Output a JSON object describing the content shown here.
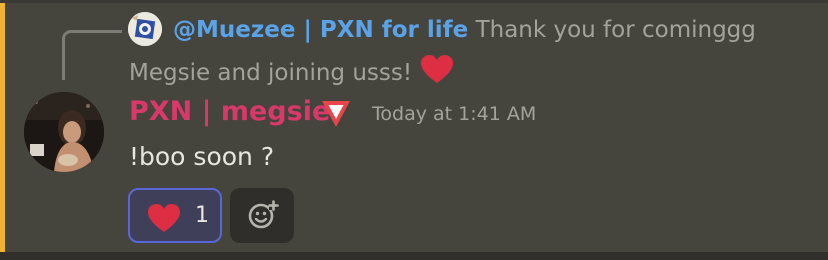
{
  "reply": {
    "author": "@Muezee | PXN for life",
    "text_line1": "Thank you for cominggg",
    "text_line2": "Megsie and joining usss!",
    "emoji": "heart-icon"
  },
  "message": {
    "username": "PXN | megsie",
    "role_icon": "downward-triangle-icon",
    "timestamp": "Today at 1:41 AM",
    "content": "!boo soon ?"
  },
  "reactions": [
    {
      "emoji": "heart-icon",
      "count": "1",
      "active": true
    }
  ],
  "add_reaction": {
    "icon": "add-emoji-icon"
  },
  "colors": {
    "background": "#45443d",
    "mention_bar": "#f0b232",
    "reply_author": "#5aa3e8",
    "username": "#d9386b",
    "reaction_border": "#5867d8",
    "heart": "#dd2e44"
  }
}
